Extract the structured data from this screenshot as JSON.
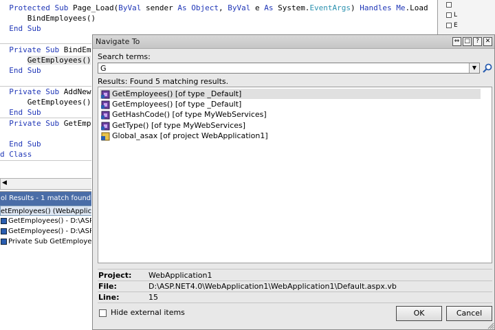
{
  "editor": {
    "lines": [
      {
        "id": 0,
        "segments": [
          {
            "t": "  ",
            "c": ""
          },
          {
            "t": "Protected",
            "c": "kw"
          },
          {
            "t": " ",
            "c": ""
          },
          {
            "t": "Sub",
            "c": "kw"
          },
          {
            "t": " Page_Load(",
            "c": ""
          },
          {
            "t": "ByVal",
            "c": "kw"
          },
          {
            "t": " sender ",
            "c": ""
          },
          {
            "t": "As",
            "c": "kw"
          },
          {
            "t": " ",
            "c": ""
          },
          {
            "t": "Object",
            "c": "kw"
          },
          {
            "t": ", ",
            "c": ""
          },
          {
            "t": "ByVal",
            "c": "kw"
          },
          {
            "t": " e ",
            "c": ""
          },
          {
            "t": "As",
            "c": "kw"
          },
          {
            "t": " System.",
            "c": ""
          },
          {
            "t": "EventArgs",
            "c": "ty"
          },
          {
            "t": ") ",
            "c": ""
          },
          {
            "t": "Handles",
            "c": "kw"
          },
          {
            "t": " ",
            "c": ""
          },
          {
            "t": "Me",
            "c": "kw"
          },
          {
            "t": ".Load",
            "c": ""
          }
        ]
      },
      {
        "id": 1,
        "segments": [
          {
            "t": "      BindEmployees()",
            "c": ""
          }
        ]
      },
      {
        "id": 2,
        "segments": [
          {
            "t": "  ",
            "c": ""
          },
          {
            "t": "End Sub",
            "c": "kw"
          }
        ]
      },
      {
        "id": 3,
        "segments": [
          {
            "t": "",
            "c": ""
          }
        ]
      },
      {
        "id": 4,
        "segments": [
          {
            "t": "  ",
            "c": ""
          },
          {
            "t": "Private",
            "c": "kw"
          },
          {
            "t": " ",
            "c": ""
          },
          {
            "t": "Sub",
            "c": "kw"
          },
          {
            "t": " BindEmp",
            "c": ""
          }
        ]
      },
      {
        "id": 5,
        "segments": [
          {
            "t": "      ",
            "c": ""
          },
          {
            "t": "GetEmployees()",
            "c": "hl"
          }
        ]
      },
      {
        "id": 6,
        "segments": [
          {
            "t": "  ",
            "c": ""
          },
          {
            "t": "End Sub",
            "c": "kw"
          }
        ]
      },
      {
        "id": 7,
        "segments": [
          {
            "t": "",
            "c": ""
          }
        ]
      },
      {
        "id": 8,
        "segments": [
          {
            "t": "  ",
            "c": ""
          },
          {
            "t": "Private",
            "c": "kw"
          },
          {
            "t": " ",
            "c": ""
          },
          {
            "t": "Sub",
            "c": "kw"
          },
          {
            "t": " AddNewE",
            "c": ""
          }
        ]
      },
      {
        "id": 9,
        "segments": [
          {
            "t": "      GetEmployees()",
            "c": ""
          }
        ]
      },
      {
        "id": 10,
        "segments": [
          {
            "t": "  ",
            "c": ""
          },
          {
            "t": "End Sub",
            "c": "kw"
          }
        ]
      },
      {
        "id": 11,
        "segments": [
          {
            "t": "  ",
            "c": ""
          },
          {
            "t": "Private",
            "c": "kw"
          },
          {
            "t": " ",
            "c": ""
          },
          {
            "t": "Sub",
            "c": "kw"
          },
          {
            "t": " GetEmpl",
            "c": ""
          }
        ]
      },
      {
        "id": 12,
        "segments": [
          {
            "t": "",
            "c": ""
          }
        ]
      },
      {
        "id": 13,
        "segments": [
          {
            "t": "  ",
            "c": ""
          },
          {
            "t": "End Sub",
            "c": "kw"
          }
        ]
      },
      {
        "id": 14,
        "segments": [
          {
            "t": "d Class",
            "c": "kw"
          }
        ]
      }
    ]
  },
  "symbol_results": {
    "header": "ol Results - 1 match found",
    "rows": [
      {
        "text": "etEmployees() (WebApplication",
        "selected": true
      },
      {
        "text": "GetEmployees() - D:\\ASP.NET",
        "selected": false
      },
      {
        "text": "GetEmployees() - D:\\ASP.NET",
        "selected": false
      },
      {
        "text": "Private Sub GetEmployees() -",
        "selected": false
      }
    ]
  },
  "dialog": {
    "title": "Navigate To",
    "title_buttons": [
      "⇔",
      "□",
      "?",
      "✕"
    ],
    "search_label": "Search terms:",
    "search_value": "G",
    "dropdown_glyph": "▼",
    "results_label": "Results: Found 5 matching results.",
    "results": [
      {
        "text": "GetEmployees() [of type _Default]",
        "icon": "method-icon",
        "selected": true
      },
      {
        "text": "GetEmployees() [of type _Default]",
        "icon": "method-icon",
        "selected": false
      },
      {
        "text": "GetHashCode() [of type MyWebServices]",
        "icon": "method-icon",
        "selected": false
      },
      {
        "text": "GetType() [of type MyWebServices]",
        "icon": "method-icon",
        "selected": false
      },
      {
        "text": "Global_asax [of project WebApplication1]",
        "icon": "class-icon",
        "selected": false
      }
    ],
    "details": {
      "project_label": "Project:",
      "project_value": "WebApplication1",
      "file_label": "File:",
      "file_value": "D:\\ASP.NET4.0\\WebApplication1\\WebApplication1\\Default.aspx.vb",
      "line_label": "Line:",
      "line_value": "15"
    },
    "hide_external_label": "Hide external items",
    "hide_external_checked": false,
    "ok_label": "OK",
    "cancel_label": "Cancel"
  },
  "colors": {
    "keyword": "#1f36b7",
    "type": "#2b91af",
    "panel_header": "#4a6da7",
    "selection": "#e0e0e0"
  }
}
